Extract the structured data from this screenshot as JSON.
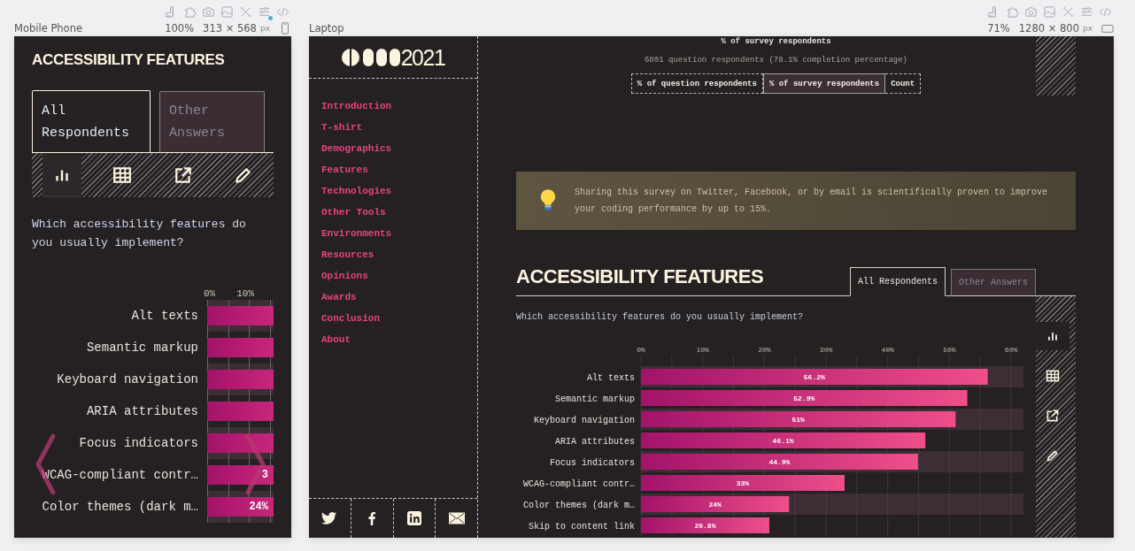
{
  "devices": [
    {
      "kind": "mobile",
      "label": "Mobile Phone",
      "zoom": "100%",
      "size": "313 × 568",
      "unit": "px",
      "badge": true
    },
    {
      "kind": "laptop",
      "label": "Laptop",
      "zoom": "71%",
      "size": "1280 × 800",
      "unit": "px",
      "badge": false
    }
  ],
  "mobile": {
    "title": "ACCESSIBILITY FEATURES",
    "tabs": [
      {
        "label": "All Respondents",
        "selected": true
      },
      {
        "label": "Other Answers",
        "selected": false
      }
    ],
    "view_buttons": [
      {
        "kind": "chart",
        "selected": true
      },
      {
        "kind": "table",
        "selected": false
      },
      {
        "kind": "share",
        "selected": false
      },
      {
        "kind": "edit",
        "selected": false
      }
    ],
    "question": "Which accessibility features do you usually implement?",
    "ticks": [
      "0%",
      "10%"
    ],
    "rows": [
      {
        "label": "Alt texts"
      },
      {
        "label": "Semantic markup"
      },
      {
        "label": "Keyboard navigation"
      },
      {
        "label": "ARIA attributes"
      },
      {
        "label": "Focus indicators"
      },
      {
        "label": "WCAG-compliant contr…",
        "value_label": "3"
      },
      {
        "label": "Color themes (dark m…",
        "value_label": "24%"
      }
    ]
  },
  "laptop": {
    "logo_text": "2021",
    "nav": [
      "Introduction",
      "T-shirt",
      "Demographics",
      "Features",
      "Technologies",
      "Other Tools",
      "Environments",
      "Resources",
      "Opinions",
      "Awards",
      "Conclusion",
      "About"
    ],
    "social": [
      {
        "kind": "twitter"
      },
      {
        "kind": "facebook"
      },
      {
        "kind": "linkedin"
      },
      {
        "kind": "email"
      }
    ],
    "previous_heading": "% of survey respondents",
    "respondents": "6801 question respondents (78.1% completion percentage)",
    "units": [
      {
        "label": "% of question respondents",
        "selected": false
      },
      {
        "label": "% of survey respondents",
        "selected": true
      },
      {
        "label": "Count",
        "selected": false
      }
    ],
    "tip": "Sharing this survey on Twitter, Facebook, or by email is scientifically proven to improve your coding performance by up to 15%.",
    "title": "ACCESSIBILITY FEATURES",
    "tabs": [
      {
        "label": "All Respondents",
        "selected": true
      },
      {
        "label": "Other Answers",
        "selected": false
      }
    ],
    "view_buttons": [
      {
        "kind": "chart",
        "selected": true
      },
      {
        "kind": "table",
        "selected": false
      },
      {
        "kind": "share",
        "selected": false
      },
      {
        "kind": "edit",
        "selected": false
      }
    ],
    "question": "Which accessibility features do you usually implement?",
    "chart_data": {
      "type": "bar",
      "orientation": "horizontal",
      "categories": [
        "Alt texts",
        "Semantic markup",
        "Keyboard navigation",
        "ARIA attributes",
        "Focus indicators",
        "WCAG-compliant contr…",
        "Color themes (dark m…",
        "Skip to content link"
      ],
      "values": [
        56.2,
        52.9,
        51,
        46.1,
        44.9,
        33,
        24,
        20.8
      ],
      "value_labels": [
        "56.2%",
        "52.9%",
        "51%",
        "46.1%",
        "44.9%",
        "33%",
        "24%",
        "20.8%"
      ],
      "xlim": [
        0,
        62
      ],
      "grid": true,
      "xticks": [
        {
          "value": 0,
          "label": "0%"
        },
        {
          "value": 10,
          "label": "10%"
        },
        {
          "value": 20,
          "label": "20%"
        },
        {
          "value": 30,
          "label": "30%"
        },
        {
          "value": 40,
          "label": "40%"
        },
        {
          "value": 50,
          "label": "50%"
        },
        {
          "value": 60,
          "label": "60%"
        }
      ]
    }
  }
}
